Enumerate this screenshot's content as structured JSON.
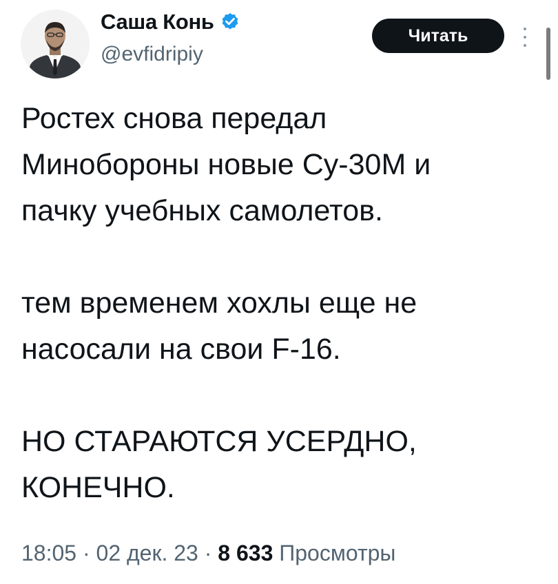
{
  "author": {
    "display_name": "Саша Конь",
    "handle": "@evfidripiy",
    "verified": true
  },
  "header": {
    "follow_label": "Читать"
  },
  "tweet": {
    "paragraphs": [
      "Ростех снова передал\nМинобороны новые Су-30М и\nпачку учебных самолетов.",
      "тем временем хохлы еще не\nнасосали на свои F-16.",
      "НО СТАРАЮТСЯ УСЕРДНО,\nКОНЕЧНО."
    ]
  },
  "meta": {
    "time": "18:05",
    "separator": "·",
    "date": "02 дек. 23",
    "views_count": "8 633",
    "views_label": "Просмотры"
  },
  "colors": {
    "text_primary": "#0f1419",
    "text_secondary": "#536471",
    "verified_badge": "#1d9bf0",
    "follow_button_bg": "#0f1419"
  },
  "icons": {
    "verified": "verified-badge-icon",
    "more": "more-vertical-icon"
  }
}
